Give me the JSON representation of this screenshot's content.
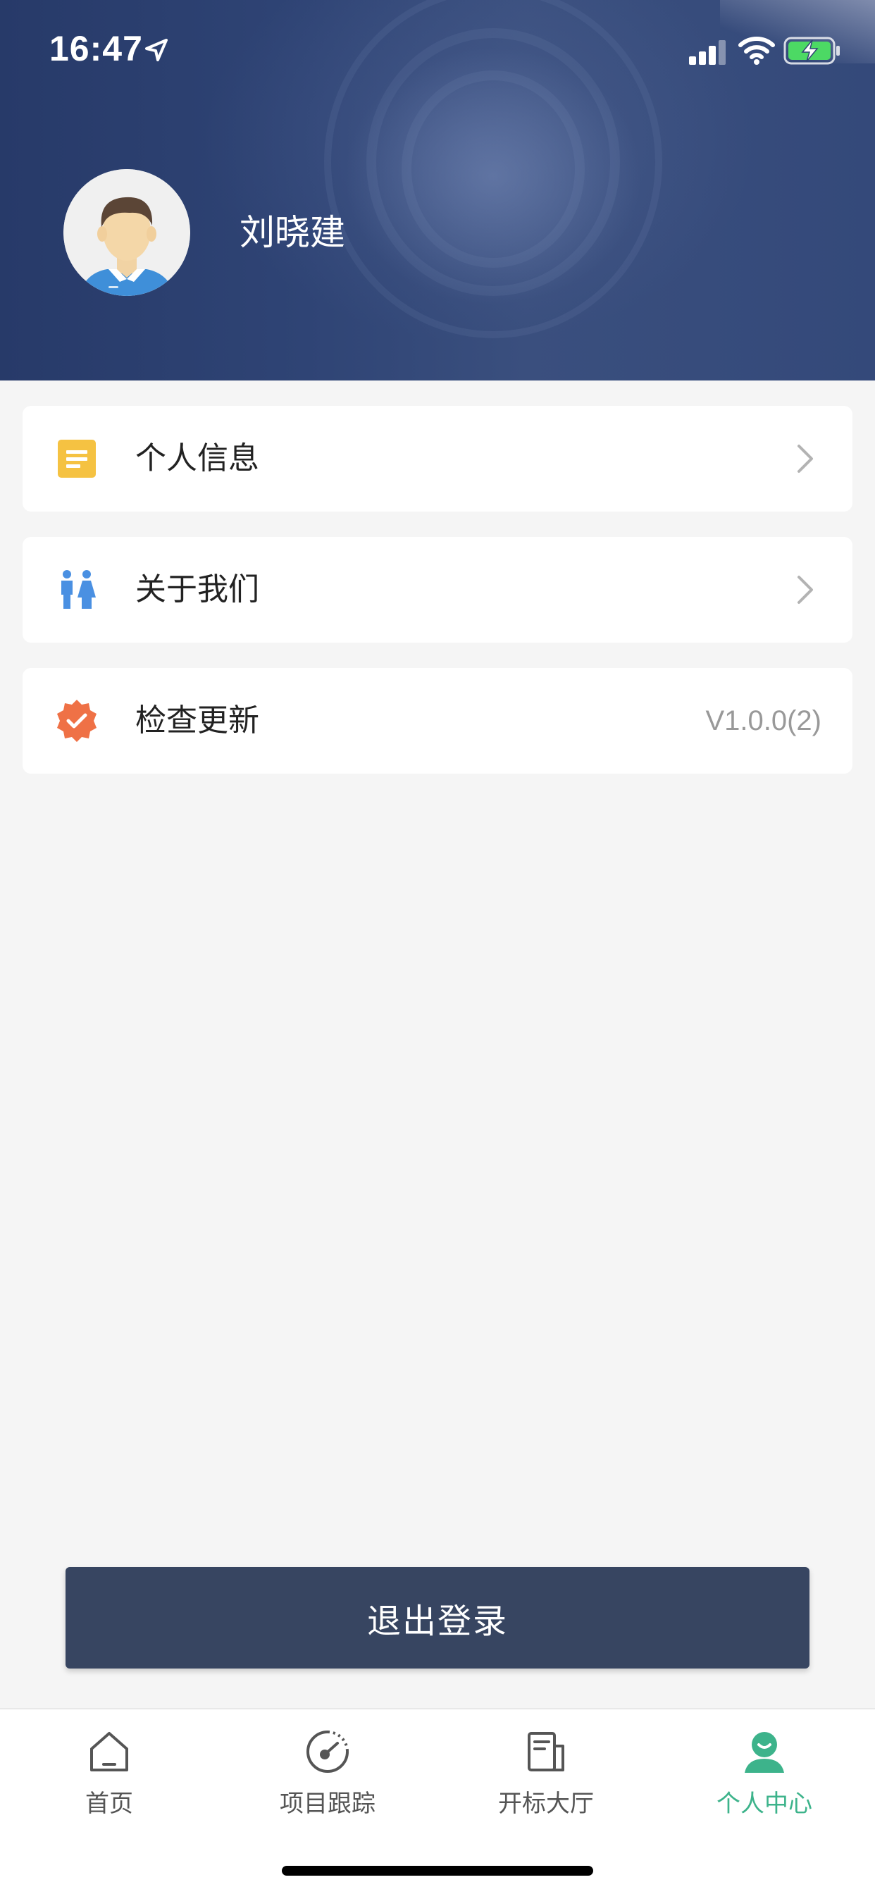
{
  "status_bar": {
    "time": "16:47",
    "icons": [
      "location-arrow-icon",
      "cellular-signal-icon",
      "wifi-icon",
      "battery-charging-icon"
    ]
  },
  "profile": {
    "name": "刘晓建",
    "avatar_icon": "male-avatar-icon"
  },
  "menu": {
    "items": [
      {
        "label": "个人信息",
        "icon": "document-icon",
        "icon_color": "#f5c242",
        "trailing": "chevron-right-icon"
      },
      {
        "label": "关于我们",
        "icon": "people-icon",
        "icon_color": "#4a90e2",
        "trailing": "chevron-right-icon"
      },
      {
        "label": "检查更新",
        "icon": "verified-badge-icon",
        "icon_color": "#ef7146",
        "trailing_text": "V1.0.0(2)"
      }
    ]
  },
  "logout": {
    "label": "退出登录"
  },
  "tab_bar": {
    "tabs": [
      {
        "label": "首页",
        "icon": "home-icon",
        "active": false
      },
      {
        "label": "项目跟踪",
        "icon": "gauge-icon",
        "active": false
      },
      {
        "label": "开标大厅",
        "icon": "newspaper-icon",
        "active": false
      },
      {
        "label": "个人中心",
        "icon": "person-icon",
        "active": true
      }
    ],
    "active_color": "#3db38b"
  },
  "colors": {
    "header": "#2f4475",
    "logout_button": "#374561",
    "background": "#f5f5f5"
  }
}
